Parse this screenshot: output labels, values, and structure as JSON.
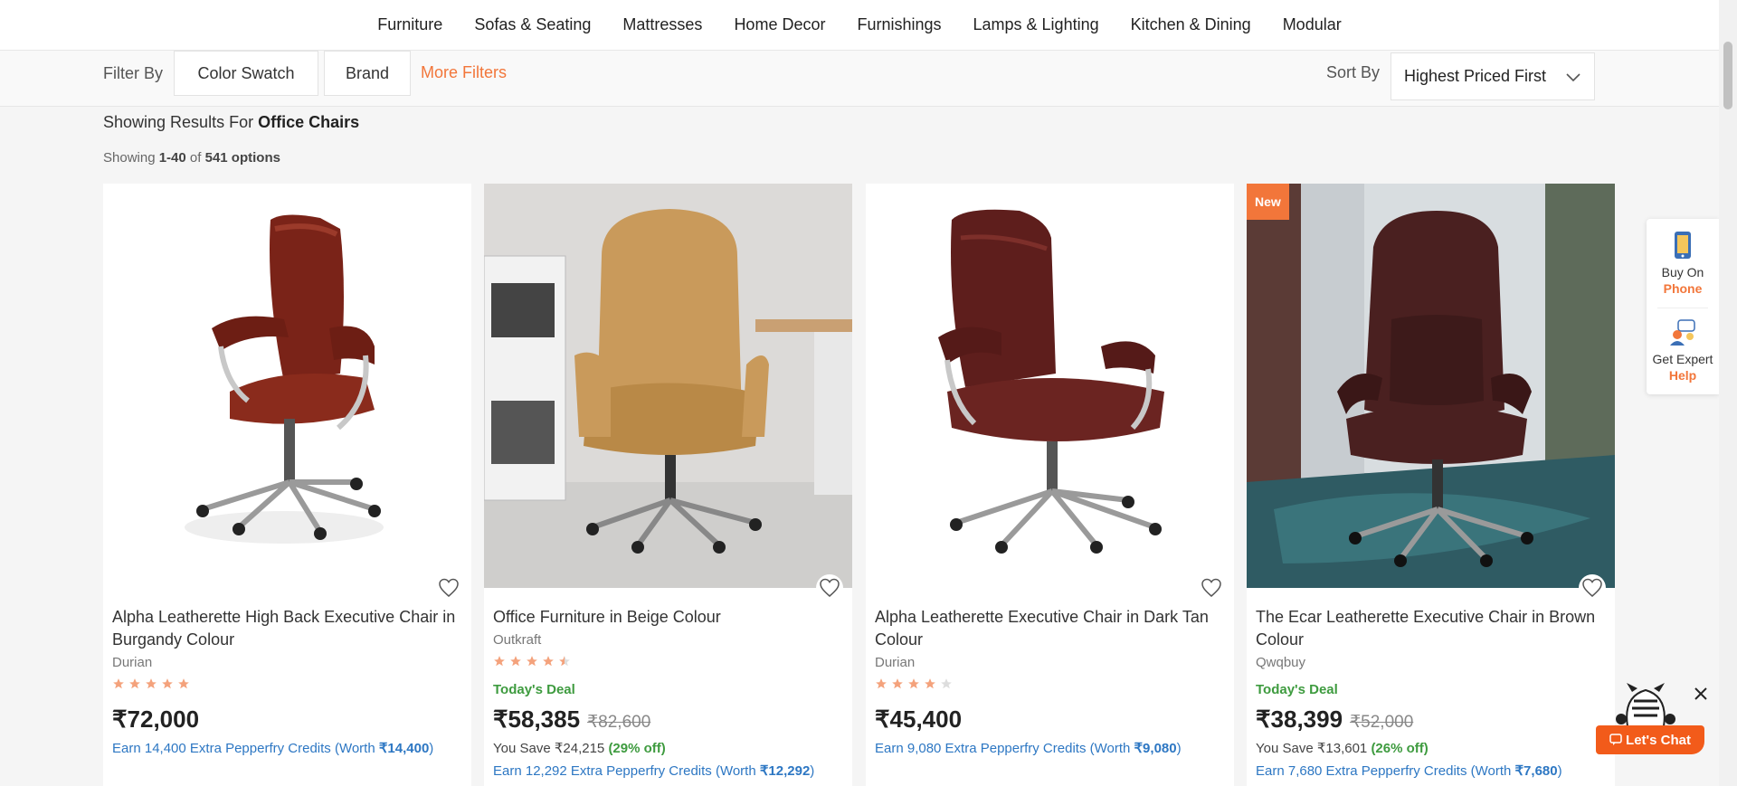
{
  "nav": {
    "items": [
      "Furniture",
      "Sofas & Seating",
      "Mattresses",
      "Home Decor",
      "Furnishings",
      "Lamps & Lighting",
      "Kitchen & Dining",
      "Modular"
    ]
  },
  "filters": {
    "label": "Filter By",
    "color_swatch": "Color Swatch",
    "brand": "Brand",
    "more": "More Filters",
    "sort_label": "Sort By",
    "sort_value": "Highest Priced First"
  },
  "results": {
    "prefix": "Showing Results For",
    "query": "Office Chairs",
    "showing": "Showing",
    "range": "1-40",
    "of": "of",
    "total": "541 options"
  },
  "products": [
    {
      "title": "Alpha Leatherette High Back Executive Chair in Burgandy Colour",
      "brand": "Durian",
      "rating": 5,
      "price": "₹72,000",
      "credits_text": "Earn 14,400 Extra Pepperfry Credits (Worth ",
      "credits_worth": "₹14,400",
      "credits_close": ")"
    },
    {
      "title": "Office Furniture in Beige Colour",
      "brand": "Outkraft",
      "rating": 4.5,
      "deal": "Today's Deal",
      "price": "₹58,385",
      "mrp": "₹82,600",
      "save": "You Save ₹24,215",
      "off": "(29% off)",
      "credits_text": "Earn 12,292 Extra Pepperfry Credits (Worth ",
      "credits_worth": "₹12,292",
      "credits_close": ")"
    },
    {
      "title": "Alpha Leatherette Executive Chair in Dark Tan Colour",
      "brand": "Durian",
      "rating": 4,
      "price": "₹45,400",
      "credits_text": "Earn 9,080 Extra Pepperfry Credits (Worth ",
      "credits_worth": "₹9,080",
      "credits_close": ")"
    },
    {
      "badge": "New",
      "title": "The Ecar Leatherette Executive Chair in Brown Colour",
      "brand": "Qwqbuy",
      "deal": "Today's Deal",
      "price": "₹38,399",
      "mrp": "₹52,000",
      "save": "You Save ₹13,601",
      "off": "(26% off)",
      "credits_text": "Earn 7,680 Extra Pepperfry Credits (Worth ",
      "credits_worth": "₹7,680",
      "credits_close": ")"
    }
  ],
  "side": {
    "buy_line1": "Buy On",
    "buy_line2": "Phone",
    "help_line1": "Get Expert",
    "help_line2": "Help"
  },
  "chat": {
    "label": "Let's Chat"
  },
  "colors": {
    "accent": "#f2763a",
    "deal": "#3e9b3f",
    "credits": "#2d77c3",
    "star": "#f4a27c"
  }
}
